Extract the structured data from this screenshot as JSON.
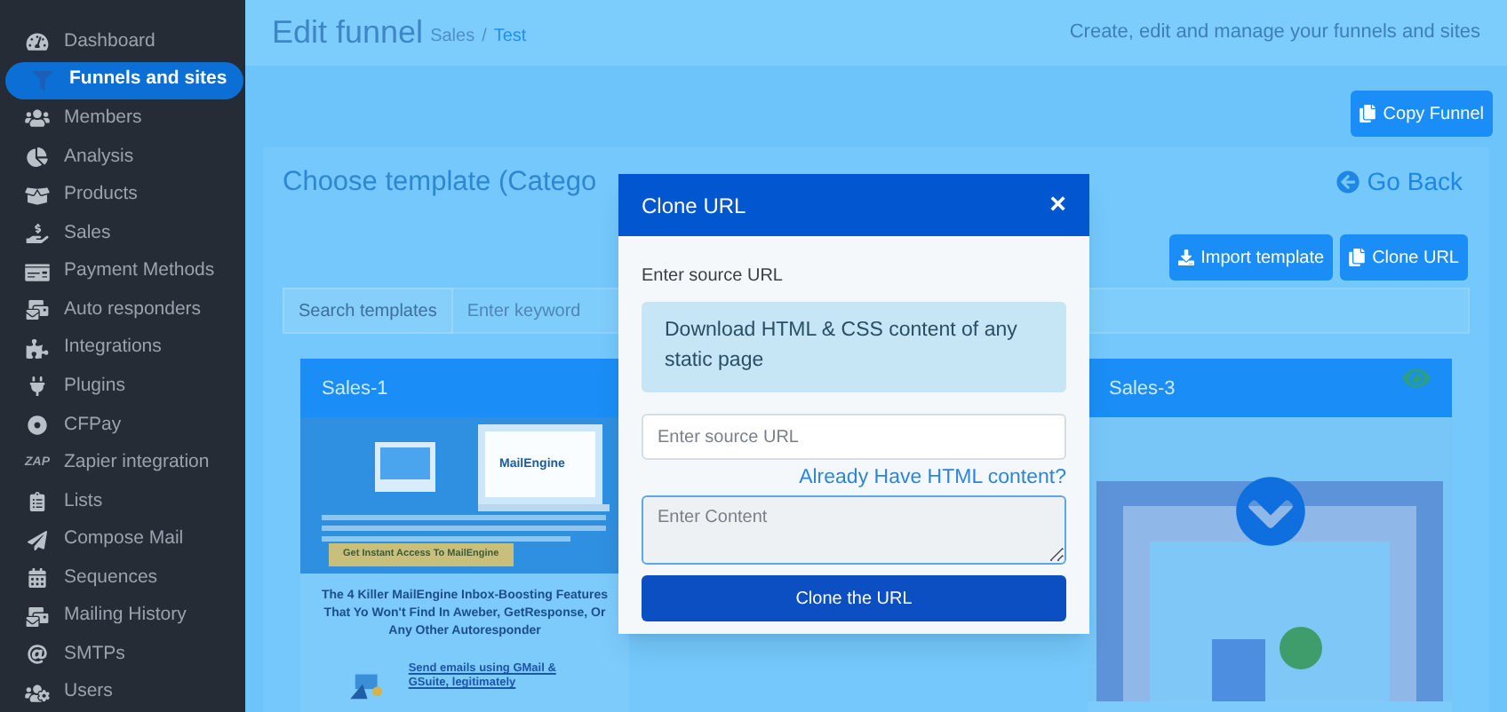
{
  "sidebar": {
    "items": [
      {
        "label": "Dashboard",
        "selected": false
      },
      {
        "label": "Funnels and sites",
        "selected": true
      },
      {
        "label": "Members",
        "selected": false
      },
      {
        "label": "Analysis",
        "selected": false
      },
      {
        "label": "Products",
        "selected": false
      },
      {
        "label": "Sales",
        "selected": false
      },
      {
        "label": "Payment Methods",
        "selected": false
      },
      {
        "label": "Auto responders",
        "selected": false
      },
      {
        "label": "Integrations",
        "selected": false
      },
      {
        "label": "Plugins",
        "selected": false
      },
      {
        "label": "CFPay",
        "selected": false
      },
      {
        "label": "Zapier integration",
        "selected": false,
        "icon_text": "ZAP"
      },
      {
        "label": "Lists",
        "selected": false
      },
      {
        "label": "Compose Mail",
        "selected": false
      },
      {
        "label": "Sequences",
        "selected": false
      },
      {
        "label": "Mailing History",
        "selected": false
      },
      {
        "label": "SMTPs",
        "selected": false
      },
      {
        "label": "Users",
        "selected": false
      }
    ]
  },
  "header": {
    "title": "Edit funnel",
    "breadcrumb": [
      "Sales",
      "Test"
    ],
    "separator": "/",
    "subtitle": "Create, edit and manage your funnels and sites"
  },
  "copy_button": "Copy Funnel",
  "card": {
    "title": "Choose template (Catego",
    "go_back": "Go Back",
    "buttons": [
      "Import template",
      "Clone URL"
    ],
    "search": {
      "label": "Search templates",
      "placeholder": "Enter keyword"
    },
    "templates": [
      {
        "title": "Sales-1",
        "kind": "mail",
        "preview": {
          "logo": "MailEngine",
          "cta": "Get Instant Access To MailEngine",
          "headline": "The 4 Killer MailEngine Inbox-Boosting Features That Yo Won't Find In Aweber, GetResponse, Or Any Other Autoresponder",
          "feature": "Send emails using GMail & GSuite, legitimately"
        }
      },
      {
        "title": "Sales-3",
        "kind": "frame"
      }
    ]
  },
  "modal": {
    "title": "Clone URL",
    "close": "×",
    "label": "Enter source URL",
    "info": "Download HTML & CSS content of any static page",
    "url_placeholder": "Enter source URL",
    "link": "Already Have HTML content?",
    "content_placeholder": "Enter Content",
    "submit": "Clone the URL"
  }
}
